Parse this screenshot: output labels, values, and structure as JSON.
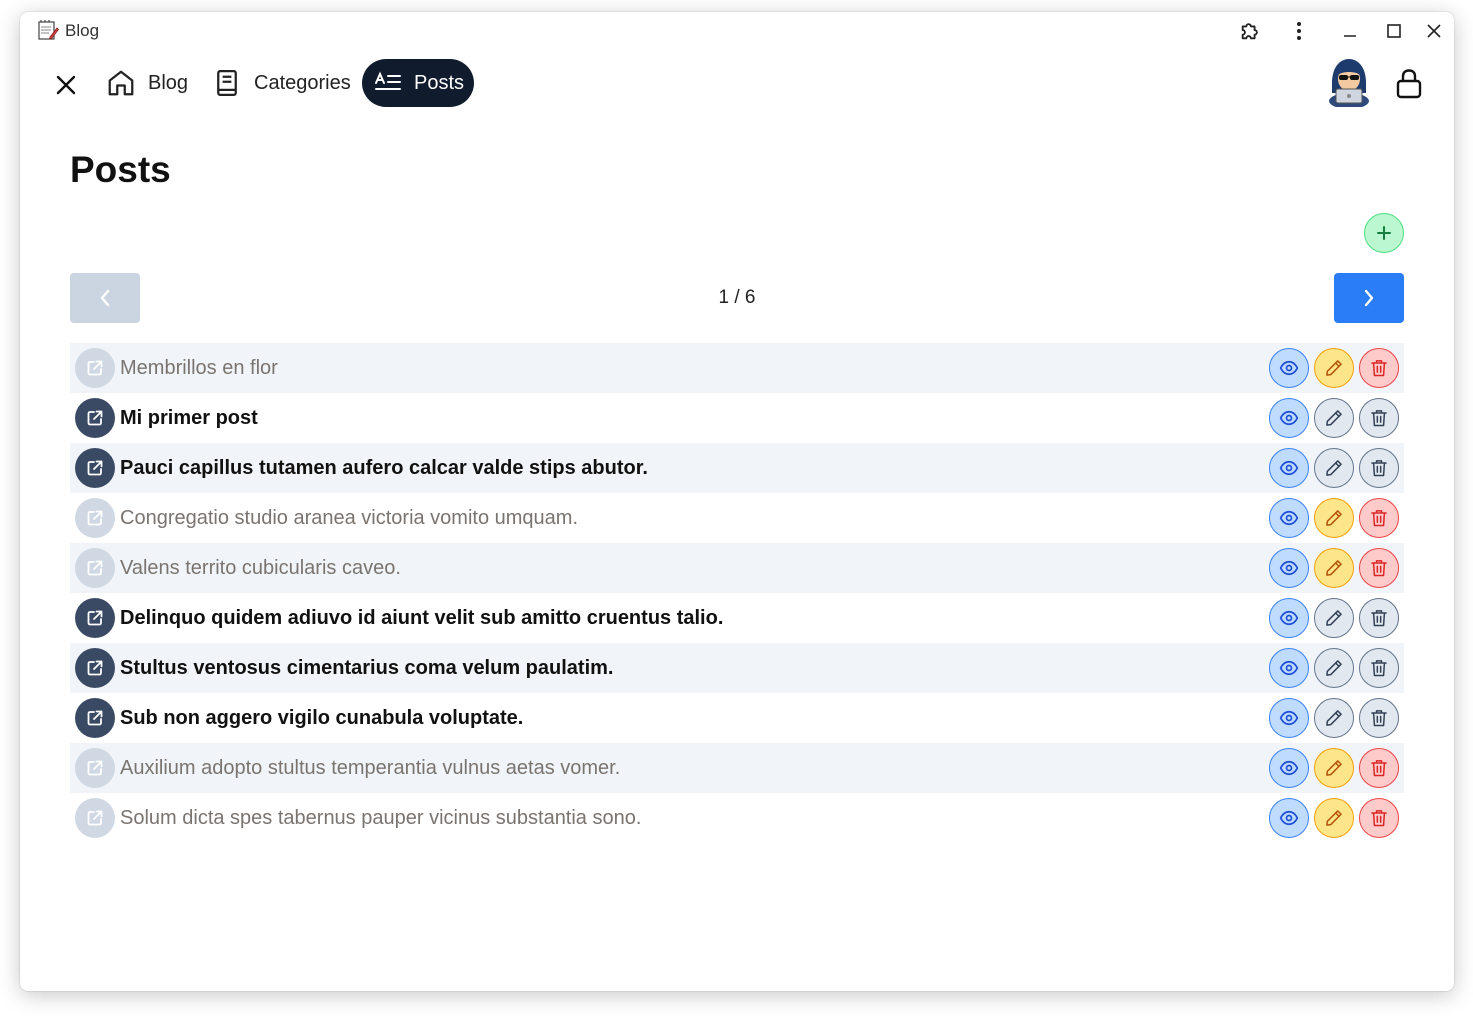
{
  "window": {
    "title": "Blog"
  },
  "nav": {
    "items": [
      {
        "label": "Blog",
        "icon": "home-icon"
      },
      {
        "label": "Categories",
        "icon": "book-icon"
      },
      {
        "label": "Posts",
        "icon": "posts-icon",
        "active": true
      }
    ]
  },
  "page": {
    "title": "Posts"
  },
  "pagination": {
    "indicator": "1 / 6",
    "current": 1,
    "total": 6
  },
  "colors": {
    "nav_active_bg": "#111b2e",
    "next_button": "#2b7cf7",
    "prev_button_disabled": "#cbd5e1",
    "add_button": "#bbf7d0",
    "view_button": "#bfdbfe",
    "edit_button": "#fde68a",
    "delete_button": "#fecaca",
    "disabled_button": "#e2e8f0"
  },
  "posts": [
    {
      "title": "Membrillos en flor",
      "published": false
    },
    {
      "title": "Mi primer post",
      "published": true
    },
    {
      "title": "Pauci capillus tutamen aufero calcar valde stips abutor.",
      "published": true
    },
    {
      "title": "Congregatio studio aranea victoria vomito umquam.",
      "published": false
    },
    {
      "title": "Valens territo cubicularis caveo.",
      "published": false
    },
    {
      "title": "Delinquo quidem adiuvo id aiunt velit sub amitto cruentus talio.",
      "published": true
    },
    {
      "title": "Stultus ventosus cimentarius coma velum paulatim.",
      "published": true
    },
    {
      "title": "Sub non aggero vigilo cunabula voluptate.",
      "published": true
    },
    {
      "title": "Auxilium adopto stultus temperantia vulnus aetas vomer.",
      "published": false
    },
    {
      "title": "Solum dicta spes tabernus pauper vicinus substantia sono.",
      "published": false
    }
  ]
}
